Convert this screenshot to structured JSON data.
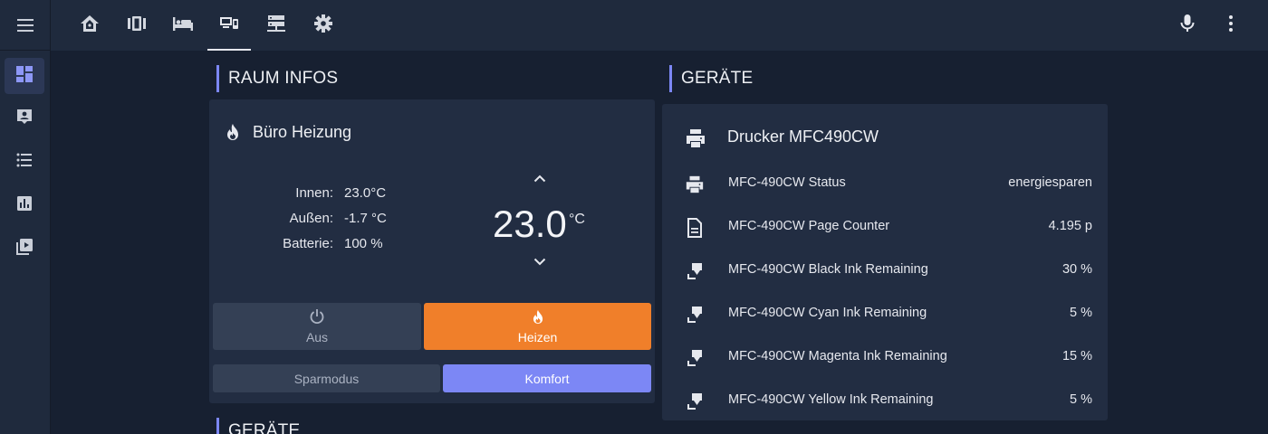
{
  "colors": {
    "accent": "#7c87f5",
    "heat": "#f07f2a",
    "background": "#172031",
    "card": "#222d42"
  },
  "sidebar": {
    "menu_icon": "hamburger-menu-icon",
    "items": [
      {
        "icon": "dashboard-icon",
        "active": true
      },
      {
        "icon": "contact-card-icon",
        "active": false
      },
      {
        "icon": "list-icon",
        "active": false
      },
      {
        "icon": "bar-chart-icon",
        "active": false
      },
      {
        "icon": "media-play-icon",
        "active": false
      }
    ]
  },
  "topbar": {
    "tabs": [
      {
        "icon": "home-icon"
      },
      {
        "icon": "carousel-icon"
      },
      {
        "icon": "bed-icon"
      },
      {
        "icon": "devices-icon",
        "active": true
      },
      {
        "icon": "server-icon"
      },
      {
        "icon": "gear-icon"
      }
    ],
    "right": [
      {
        "icon": "microphone-icon"
      },
      {
        "icon": "more-vertical-icon"
      }
    ]
  },
  "left_section": {
    "title": "RAUM INFOS",
    "next_title": "GERÄTE"
  },
  "thermostat": {
    "name": "Büro Heizung",
    "info": [
      {
        "label": "Innen:",
        "value": "23.0°C"
      },
      {
        "label": "Außen:",
        "value": "-1.7 °C"
      },
      {
        "label": "Batterie:",
        "value": "100 %"
      }
    ],
    "target": "23.0",
    "target_unit": "°C",
    "modes": {
      "off": "Aus",
      "heat": "Heizen"
    },
    "presets": {
      "eco": "Sparmodus",
      "comfort": "Komfort"
    }
  },
  "right_section": {
    "title": "GERÄTE"
  },
  "device": {
    "name": "Drucker MFC490CW",
    "entities": [
      {
        "icon": "printer-icon",
        "name": "MFC-490CW Status",
        "value": "energiesparen"
      },
      {
        "icon": "file-document-icon",
        "name": "MFC-490CW Page Counter",
        "value": "4.195 p"
      },
      {
        "icon": "ink-cartridge-icon",
        "name": "MFC-490CW Black Ink Remaining",
        "value": "30 %"
      },
      {
        "icon": "ink-cartridge-icon",
        "name": "MFC-490CW Cyan Ink Remaining",
        "value": "5 %"
      },
      {
        "icon": "ink-cartridge-icon",
        "name": "MFC-490CW Magenta Ink Remaining",
        "value": "15 %"
      },
      {
        "icon": "ink-cartridge-icon",
        "name": "MFC-490CW Yellow Ink Remaining",
        "value": "5 %"
      }
    ]
  }
}
